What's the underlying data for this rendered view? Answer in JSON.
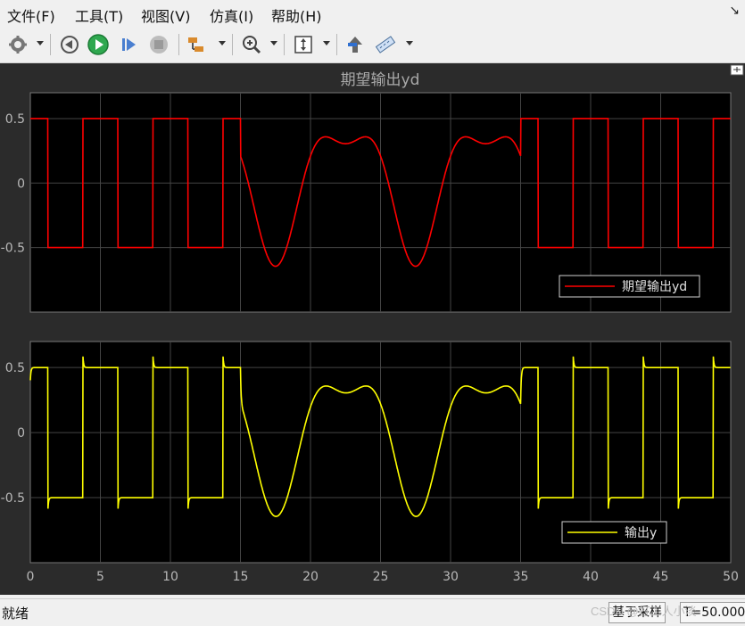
{
  "menu": [
    {
      "label": "文件(F)"
    },
    {
      "label": "工具(T)"
    },
    {
      "label": "视图(V)"
    },
    {
      "label": "仿真(I)"
    },
    {
      "label": "帮助(H)"
    }
  ],
  "toolbar": {
    "icons": [
      "gear-icon",
      "step-back-icon",
      "run-icon",
      "step-forward-icon",
      "stop-icon",
      "signal-select-icon",
      "zoom-icon",
      "autoscale-icon",
      "highlight-icon",
      "measure-icon"
    ]
  },
  "status": {
    "ready": "就绪",
    "mode": "基于采样",
    "time": "T=50.000"
  },
  "watermark": "CSDN @打工人小淡",
  "colors": {
    "top_line": "#ff0000",
    "bottom_line": "#ffff00",
    "axes_bg": "#000000",
    "figure_bg": "#2b2b2b"
  },
  "chart_data": [
    {
      "type": "line",
      "title": "期望输出yd",
      "xlim": [
        0,
        50
      ],
      "ylim": [
        -1,
        0.7
      ],
      "yticks": [
        "0.5",
        "0",
        "-0.5"
      ],
      "grid": true,
      "legend": {
        "position": "bottom-right",
        "entries": [
          "期望输出yd"
        ]
      },
      "series": [
        {
          "name": "期望输出yd",
          "color": "#ff0000",
          "description_of_shape": "square wave ±0.5 with period 5 on t∈[0,15) and t∈(35,50]; smooth oscillation between t=15 and t=35 (min -0.8 at 17.5 and 27.5, peaks ~0.4, dip ~0.2)"
        }
      ]
    },
    {
      "type": "line",
      "title": "",
      "xlim": [
        0,
        50
      ],
      "ylim": [
        -1,
        0.7
      ],
      "xticks": [
        "0",
        "5",
        "10",
        "15",
        "20",
        "25",
        "30",
        "35",
        "40",
        "45",
        "50"
      ],
      "yticks": [
        "0.5",
        "0",
        "-0.5"
      ],
      "grid": true,
      "legend": {
        "position": "bottom-right",
        "entries": [
          "输出y"
        ]
      },
      "series": [
        {
          "name": "输出y",
          "color": "#ffff00"
        }
      ]
    }
  ]
}
